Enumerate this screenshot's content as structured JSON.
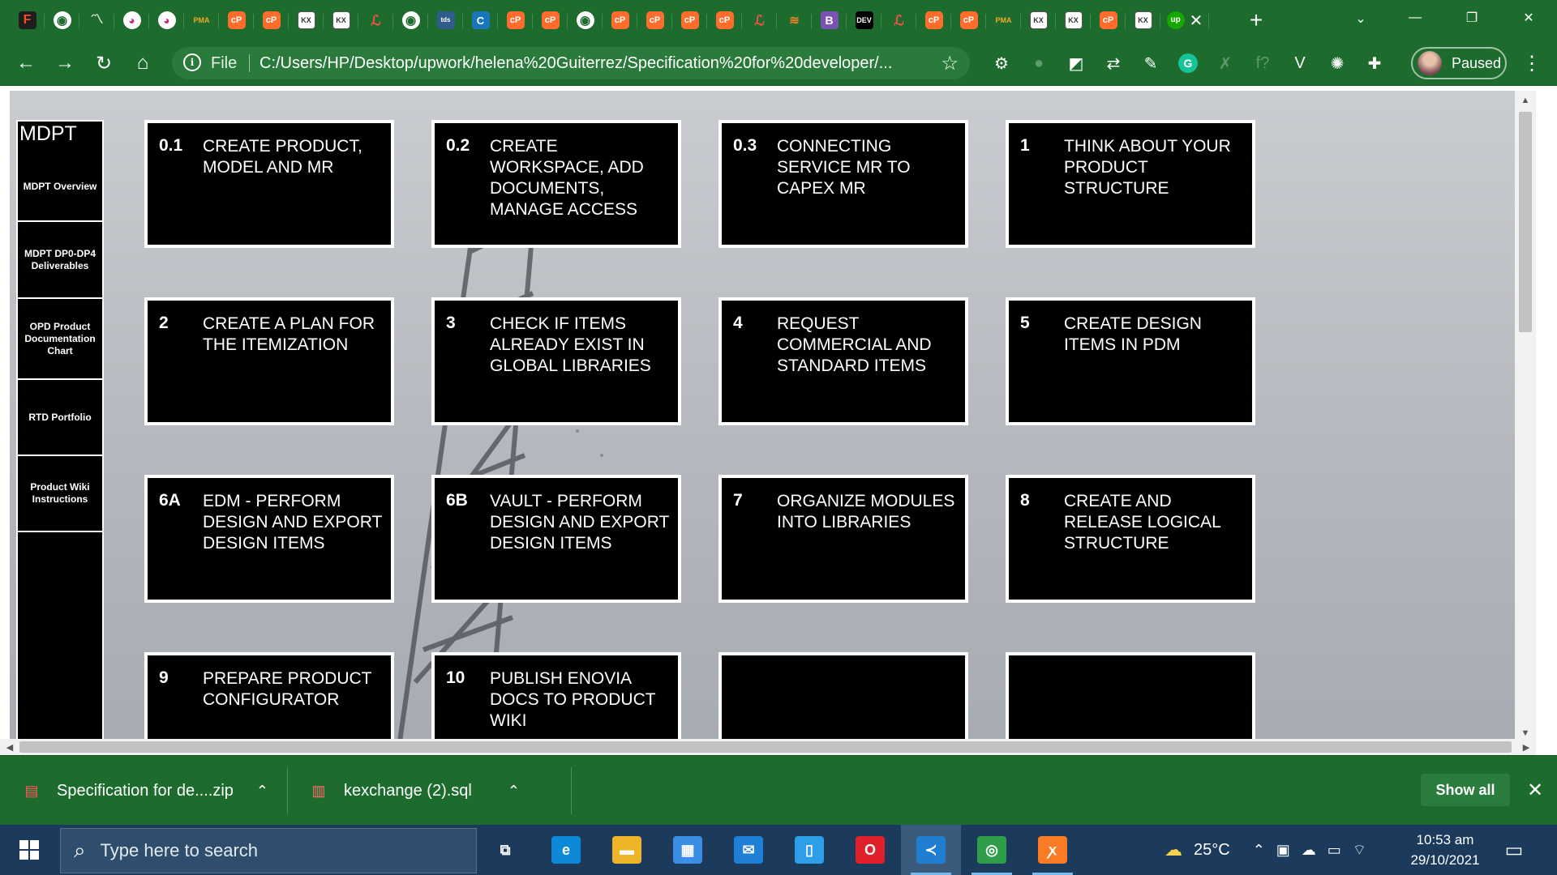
{
  "browser": {
    "tab_favicons": [
      {
        "name": "figma",
        "glyph": "F",
        "cls": "f-figma"
      },
      {
        "name": "globe",
        "glyph": "◉",
        "cls": "f-globe"
      },
      {
        "name": "analytics",
        "glyph": "〽",
        "cls": "f-chart"
      },
      {
        "name": "pink-app",
        "glyph": "◕",
        "cls": "f-pink"
      },
      {
        "name": "pink-app",
        "glyph": "◕",
        "cls": "f-pink"
      },
      {
        "name": "phpmyadmin",
        "glyph": "PMA",
        "cls": "f-pma"
      },
      {
        "name": "cpanel",
        "glyph": "cP",
        "cls": "f-cp"
      },
      {
        "name": "cpanel",
        "glyph": "cP",
        "cls": "f-cp"
      },
      {
        "name": "kx",
        "glyph": "KX",
        "cls": "f-kx"
      },
      {
        "name": "kx",
        "glyph": "KX",
        "cls": "f-kx"
      },
      {
        "name": "laravel",
        "glyph": "ℒ",
        "cls": "f-lara"
      },
      {
        "name": "globe",
        "glyph": "◉",
        "cls": "f-globe"
      },
      {
        "name": "tds",
        "glyph": "tds",
        "cls": "f-tds"
      },
      {
        "name": "c-app",
        "glyph": "C",
        "cls": "f-c"
      },
      {
        "name": "cpanel",
        "glyph": "cP",
        "cls": "f-cp"
      },
      {
        "name": "cpanel",
        "glyph": "cP",
        "cls": "f-cp"
      },
      {
        "name": "globe",
        "glyph": "◉",
        "cls": "f-globe"
      },
      {
        "name": "cpanel",
        "glyph": "cP",
        "cls": "f-cp"
      },
      {
        "name": "cpanel",
        "glyph": "cP",
        "cls": "f-cp"
      },
      {
        "name": "cpanel",
        "glyph": "cP",
        "cls": "f-cp"
      },
      {
        "name": "cpanel",
        "glyph": "cP",
        "cls": "f-cp"
      },
      {
        "name": "laravel",
        "glyph": "ℒ",
        "cls": "f-lara"
      },
      {
        "name": "stackoverflow",
        "glyph": "≋",
        "cls": "f-so"
      },
      {
        "name": "bootstrap",
        "glyph": "B",
        "cls": "f-b"
      },
      {
        "name": "dev",
        "glyph": "DEV",
        "cls": "f-dev"
      },
      {
        "name": "laravel",
        "glyph": "ℒ",
        "cls": "f-lara"
      },
      {
        "name": "cpanel",
        "glyph": "cP",
        "cls": "f-cp"
      },
      {
        "name": "cpanel",
        "glyph": "cP",
        "cls": "f-cp"
      },
      {
        "name": "phpmyadmin",
        "glyph": "PMA",
        "cls": "f-pma"
      },
      {
        "name": "kx",
        "glyph": "KX",
        "cls": "f-kx"
      },
      {
        "name": "kx",
        "glyph": "KX",
        "cls": "f-kx"
      },
      {
        "name": "cpanel",
        "glyph": "cP",
        "cls": "f-cp"
      },
      {
        "name": "kx",
        "glyph": "KX",
        "cls": "f-kx"
      },
      {
        "name": "upwork",
        "glyph": "up",
        "cls": "f-up"
      }
    ],
    "new_tab_glyph": "+",
    "tab_search_glyph": "⌄",
    "window_controls": {
      "minimize": "—",
      "restore": "❐",
      "close": "✕"
    },
    "tab_close_glyph": "✕",
    "nav": {
      "back": "←",
      "forward": "→",
      "reload": "↻",
      "home": "⌂"
    },
    "omnibox": {
      "info_glyph": "i",
      "scheme": "File",
      "url": "C:/Users/HP/Desktop/upwork/helena%20Guiterrez/Specification%20for%20developer/...",
      "star_glyph": "☆"
    },
    "extensions": [
      {
        "name": "gear-extension",
        "glyph": "⚙",
        "dim": false
      },
      {
        "name": "dim-extension",
        "glyph": "●",
        "dim": true
      },
      {
        "name": "eraser-extension",
        "glyph": "◩",
        "dim": false
      },
      {
        "name": "sync-extension",
        "glyph": "⇄",
        "dim": false
      },
      {
        "name": "pen-extension",
        "glyph": "✎",
        "dim": false
      },
      {
        "name": "grammarly-extension",
        "glyph": "G",
        "dim": false,
        "grammarly": true
      },
      {
        "name": "x-extension",
        "glyph": "✗",
        "dim": true
      },
      {
        "name": "formula-extension",
        "glyph": "f?",
        "dim": true
      },
      {
        "name": "vue-extension",
        "glyph": "V",
        "dim": false
      },
      {
        "name": "bug-extension",
        "glyph": "✺",
        "dim": false
      },
      {
        "name": "puzzle-extension",
        "glyph": "✚",
        "dim": false
      }
    ],
    "profile_label": "Paused",
    "menu_glyph": "⋮"
  },
  "page": {
    "sidebar": {
      "title": "MDPT",
      "items": [
        "MDPT Overview",
        "MDPT DP0-DP4 Deliverables",
        "OPD Product Documentation Chart",
        "RTD Portfolio",
        "Product Wiki Instructions"
      ]
    },
    "steps": [
      {
        "num": "0.1",
        "label": "CREATE PRODUCT, MODEL AND MR"
      },
      {
        "num": "0.2",
        "label": "CREATE WORKSPACE, ADD DOCUMENTS, MANAGE ACCESS"
      },
      {
        "num": "0.3",
        "label": "CONNECTING SERVICE MR TO CAPEX MR"
      },
      {
        "num": "1",
        "label": "THINK ABOUT YOUR PRODUCT STRUCTURE"
      },
      {
        "num": "2",
        "label": "CREATE A PLAN FOR THE ITEMIZATION"
      },
      {
        "num": "3",
        "label": "CHECK IF ITEMS ALREADY EXIST IN GLOBAL LIBRARIES"
      },
      {
        "num": "4",
        "label": "REQUEST COMMERCIAL AND STANDARD ITEMS"
      },
      {
        "num": "5",
        "label": "CREATE DESIGN ITEMS IN PDM"
      },
      {
        "num": "6A",
        "label": "EDM - PERFORM DESIGN AND EXPORT DESIGN ITEMS"
      },
      {
        "num": "6B",
        "label": "VAULT - PERFORM DESIGN AND EXPORT DESIGN ITEMS"
      },
      {
        "num": "7",
        "label": "ORGANIZE MODULES INTO LIBRARIES"
      },
      {
        "num": "8",
        "label": "CREATE AND RELEASE LOGICAL STRUCTURE"
      },
      {
        "num": "9",
        "label": "PREPARE PRODUCT CONFIGURATOR"
      },
      {
        "num": "10",
        "label": "PUBLISH ENOVIA DOCS TO PRODUCT WIKI"
      },
      {
        "num": "",
        "label": ""
      },
      {
        "num": "",
        "label": ""
      }
    ],
    "scroll": {
      "up": "▲",
      "down": "▼",
      "left": "◀",
      "right": "▶"
    }
  },
  "downloads": {
    "items": [
      {
        "name": "Specification for de....zip",
        "icon": "zip-file-icon",
        "glyph": "▤",
        "color": "#ff5a5a"
      },
      {
        "name": "kexchange (2).sql",
        "icon": "sql-file-icon",
        "glyph": "▥",
        "color": "#ff6b6b"
      }
    ],
    "chevron": "⌃",
    "show_all": "Show all",
    "close_glyph": "✕"
  },
  "taskbar": {
    "search_placeholder": "Type here to search",
    "search_glyph": "⌕",
    "apps": [
      {
        "name": "task-view",
        "glyph": "⧉",
        "bg": "transparent",
        "open": false,
        "active": false
      },
      {
        "name": "edge",
        "glyph": "e",
        "bg": "#0c8ad8",
        "open": false,
        "active": false
      },
      {
        "name": "file-explorer",
        "glyph": "▬",
        "bg": "#f0b428",
        "open": false,
        "active": false
      },
      {
        "name": "microsoft-store",
        "glyph": "▦",
        "bg": "#3b8ee6",
        "open": false,
        "active": false
      },
      {
        "name": "mail",
        "glyph": "✉",
        "bg": "#1e7fd6",
        "open": false,
        "active": false
      },
      {
        "name": "phone-app",
        "glyph": "▯",
        "bg": "#2d9fe8",
        "open": false,
        "active": false
      },
      {
        "name": "opera",
        "glyph": "O",
        "bg": "#e0202a",
        "open": false,
        "active": false
      },
      {
        "name": "vscode",
        "glyph": "≺",
        "bg": "#1f7ed0",
        "open": true,
        "active": true
      },
      {
        "name": "chrome",
        "glyph": "◎",
        "bg": "#2e9e4a",
        "open": true,
        "active": false
      },
      {
        "name": "xampp",
        "glyph": "ꭗ",
        "bg": "#fb7a24",
        "open": true,
        "active": false
      }
    ],
    "weather": "25°C",
    "tray_glyphs": [
      "⌃",
      "▣",
      "☁",
      "▭",
      "⌔"
    ],
    "time": "10:53 am",
    "date": "29/10/2021",
    "notification_glyph": "▭"
  }
}
